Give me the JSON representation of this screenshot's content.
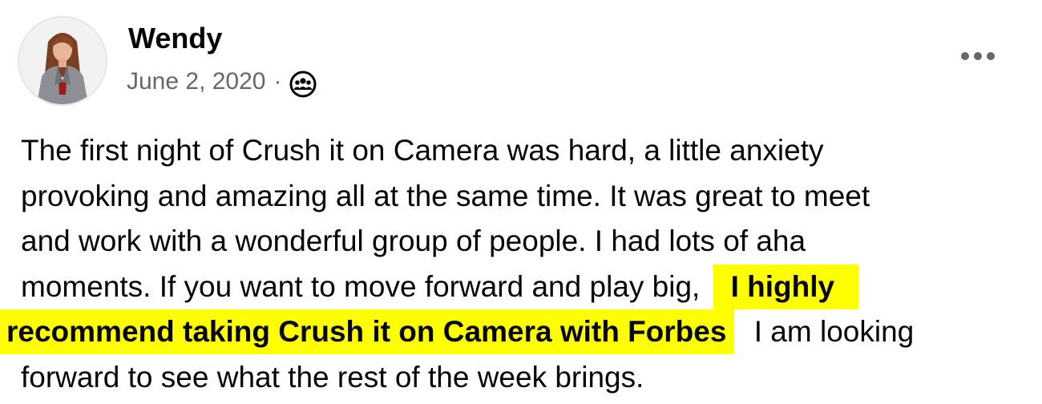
{
  "post": {
    "author": "Wendy",
    "date": "June 2, 2020",
    "separator": "·",
    "audience_icon": "group-icon",
    "more_icon": "more-options-icon",
    "body": {
      "line1": "The first night of Crush it on Camera was hard, a little anxiety",
      "line2": "provoking and amazing all at the same time.  It was great to meet",
      "line3": "and work with a wonderful group of people.  I had lots of aha",
      "line4_text": "moments.  If you want to move forward and play big,",
      "line4_highlight": "I highly",
      "line5_highlight": "recommend taking Crush it on Camera with Forbes",
      "line5_text": "I am looking",
      "line6": "forward to see what the rest of the week brings."
    }
  },
  "colors": {
    "highlight": "#ffff00",
    "text": "#050505",
    "secondary_text": "#65676b"
  }
}
